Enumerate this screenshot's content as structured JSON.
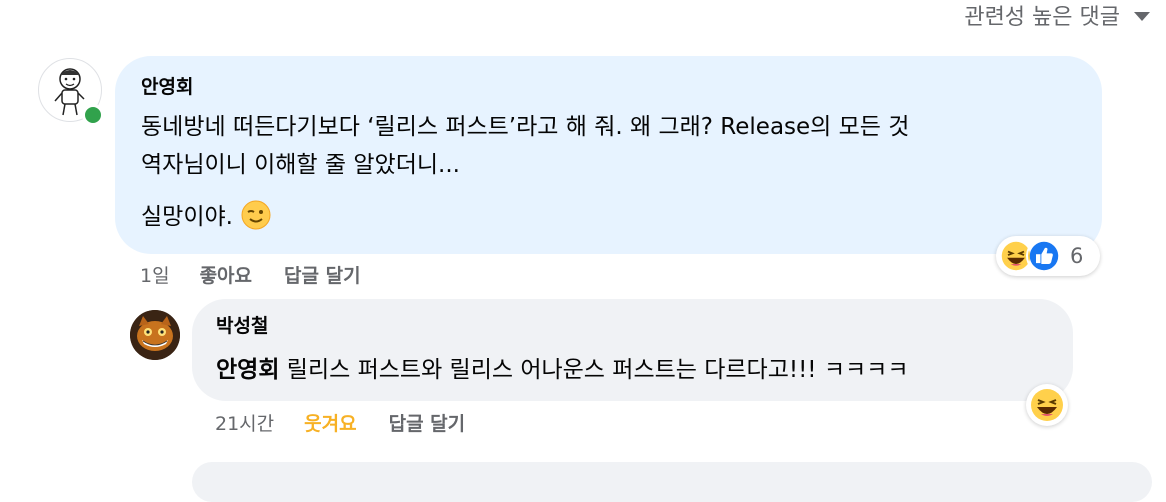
{
  "sort": {
    "label": "관련성 높은 댓글"
  },
  "comment": {
    "author": "안영회",
    "lines": [
      "동네방네 떠든다기보다 ‘릴리스 퍼스트’라고 해 줘. 왜 그래? Release의 모든 것",
      "역자님이니 이해할 줄 알았더니...",
      "실망이야."
    ],
    "reactions": {
      "icons": [
        "laugh-emoji",
        "like-thumb"
      ],
      "count": "6"
    },
    "time": "1일",
    "like_label": "좋아요",
    "reply_label": "답글 달기"
  },
  "reply": {
    "author": "박성철",
    "mention": "안영회",
    "text": " 릴리스 퍼스트와 릴리스 어나운스 퍼스트는 다르다고!!!  ㅋㅋㅋㅋ",
    "reactions": {
      "icons": [
        "laugh-emoji"
      ]
    },
    "time": "21시간",
    "laugh_label": "웃겨요",
    "reply_label": "답글 달기"
  },
  "colors": {
    "primary_bubble": "#e7f3ff",
    "reply_bubble": "#f0f2f5",
    "laugh_active": "#f7b125",
    "online": "#31a24c"
  }
}
